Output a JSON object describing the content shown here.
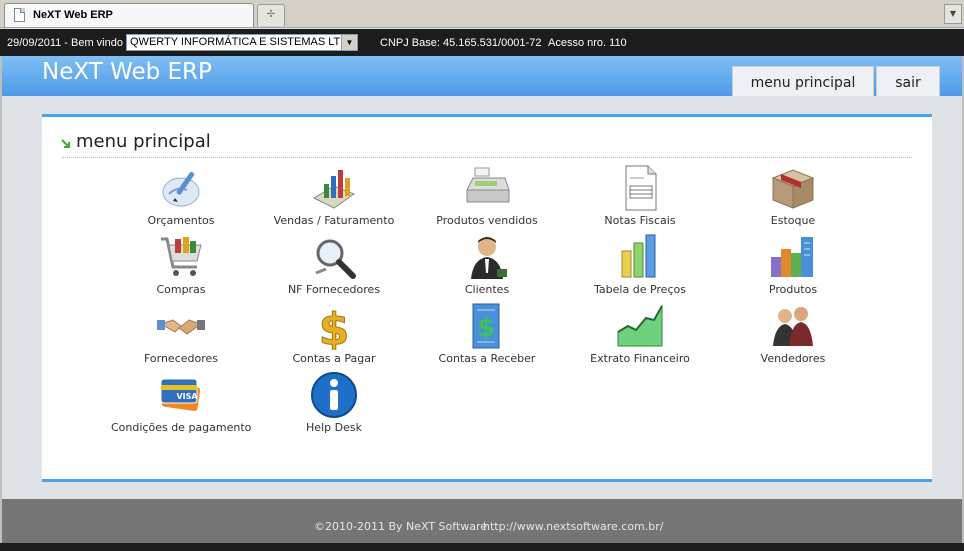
{
  "browser": {
    "tab_title": "NeXT Web ERP",
    "new_tab_symbol": "✢"
  },
  "infobar": {
    "date_greeting": "29/09/2011 - Bem vindo",
    "company_selected": "QWERTY INFORMÁTICA E SISTEMAS LTDA",
    "cnpj": "CNPJ Base: 45.165.531/0001-72",
    "access": "Acesso nro. 110"
  },
  "header": {
    "brand": "NeXT Web ERP",
    "nav": {
      "menu_principal": "menu principal",
      "sair": "sair"
    }
  },
  "panel": {
    "title": "menu principal",
    "items": [
      {
        "label": "Orçamentos",
        "icon": "quote-pen-icon"
      },
      {
        "label": "Vendas / Faturamento",
        "icon": "sales-chart-icon"
      },
      {
        "label": "Produtos vendidos",
        "icon": "cash-register-icon"
      },
      {
        "label": "Notas Fiscais",
        "icon": "invoice-document-icon"
      },
      {
        "label": "Estoque",
        "icon": "stock-box-icon"
      },
      {
        "label": "Compras",
        "icon": "shopping-cart-icon"
      },
      {
        "label": "NF Fornecedores",
        "icon": "magnifier-search-icon"
      },
      {
        "label": "Clientes",
        "icon": "client-person-icon"
      },
      {
        "label": "Tabela de Preços",
        "icon": "bar-chart-icon"
      },
      {
        "label": "Produtos",
        "icon": "buildings-icon"
      },
      {
        "label": "Fornecedores",
        "icon": "handshake-icon"
      },
      {
        "label": "Contas a Pagar",
        "icon": "dollar-sign-icon"
      },
      {
        "label": "Contas a Receber",
        "icon": "dollar-building-icon"
      },
      {
        "label": "Extrato Financeiro",
        "icon": "area-chart-icon"
      },
      {
        "label": "Vendedores",
        "icon": "sellers-group-icon"
      },
      {
        "label": "Condições de pagamento",
        "icon": "credit-card-icon"
      },
      {
        "label": "Help Desk",
        "icon": "info-icon"
      }
    ]
  },
  "footer": {
    "copyright": "©2010-2011 By NeXT Software",
    "url": "http://www.nextsoftware.com.br/"
  },
  "colors": {
    "header_blue": "#4d9ae6",
    "panel_border": "#4aa3e8",
    "footer_gray": "#757575",
    "infobar_black": "#1c1c1c"
  }
}
